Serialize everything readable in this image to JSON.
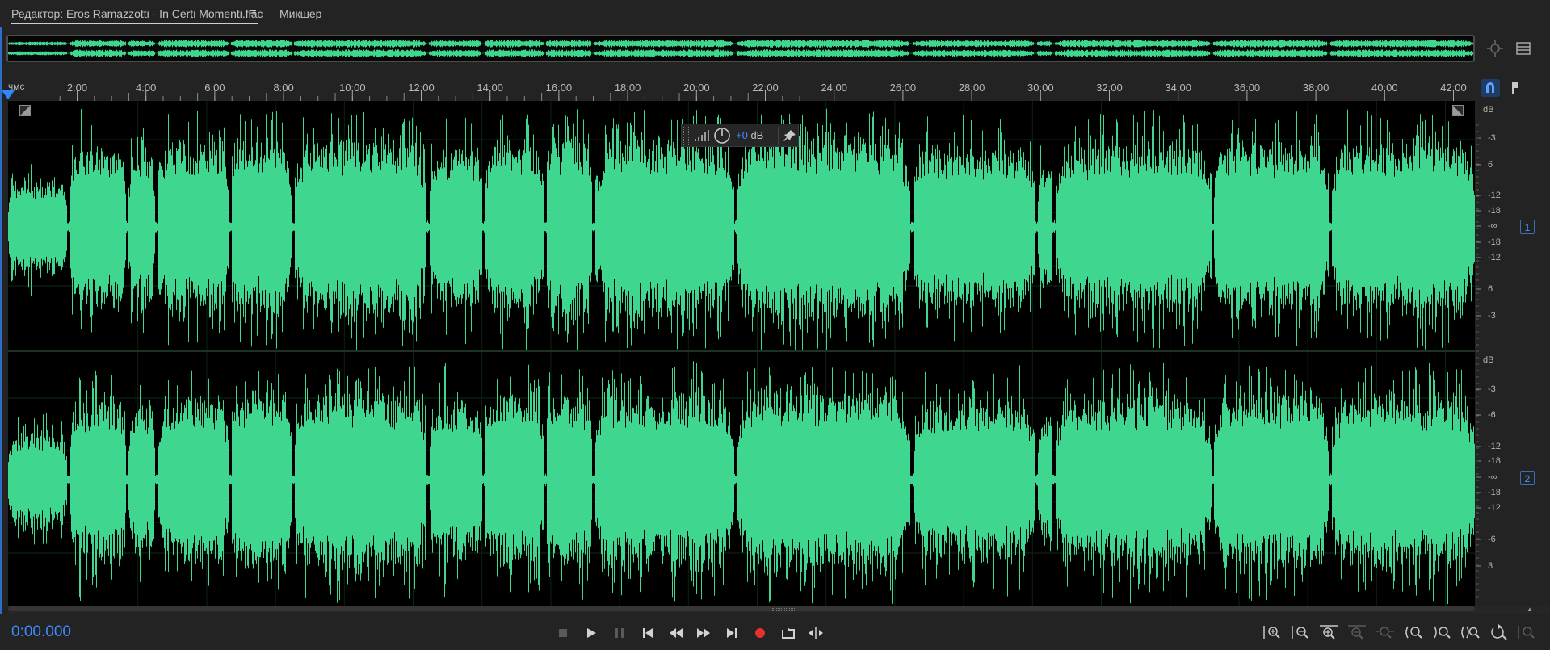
{
  "tabs": {
    "editor_label": "Редактор: Eros Ramazzotti - In Certi Momenti.flac",
    "menu_icon": "hamburger-menu-icon",
    "mixer_label": "Микшер"
  },
  "ruler": {
    "unit": "чмс",
    "ticks": [
      "2:00",
      "4:00",
      "6:00",
      "8:00",
      "10:00",
      "12:00",
      "14:00",
      "16:00",
      "18:00",
      "20:00",
      "22:00",
      "24:00",
      "26:00",
      "28:00",
      "30:00",
      "32:00",
      "34:00",
      "36:00",
      "38:00",
      "40:00",
      "42:00"
    ]
  },
  "hud": {
    "volume_number": "+0",
    "volume_unit": " dB"
  },
  "db_scale": {
    "unit": "dB",
    "channel1_labels": [
      "-3",
      "6",
      "-12",
      "-18",
      "-∞",
      "-18",
      "-12",
      "6",
      "-3"
    ],
    "channel2_labels": [
      "-3",
      "-6",
      "-12",
      "-18",
      "-∞",
      "-18",
      "-12",
      "-6",
      "3"
    ],
    "channel1_badge": "1",
    "channel2_badge": "2"
  },
  "transport": {
    "timecode": "0:00.000",
    "buttons": [
      "stop",
      "play",
      "pause",
      "go-to-start",
      "rewind",
      "fast-forward",
      "go-to-end",
      "record",
      "loop-playback",
      "skip-selection"
    ]
  },
  "zoom_buttons": [
    "zoom-in-amplitude",
    "zoom-out-amplitude",
    "zoom-in-time",
    "zoom-out-time",
    "zoom-out-full",
    "zoom-in-start",
    "zoom-in-end",
    "zoom-selection",
    "zoom-reset",
    "zoom-to-selection",
    "zoom-full-vertical"
  ],
  "colors": {
    "waveform": "#3fd690",
    "accent": "#3b8cff",
    "record": "#e8312f",
    "background": "#232323"
  }
}
